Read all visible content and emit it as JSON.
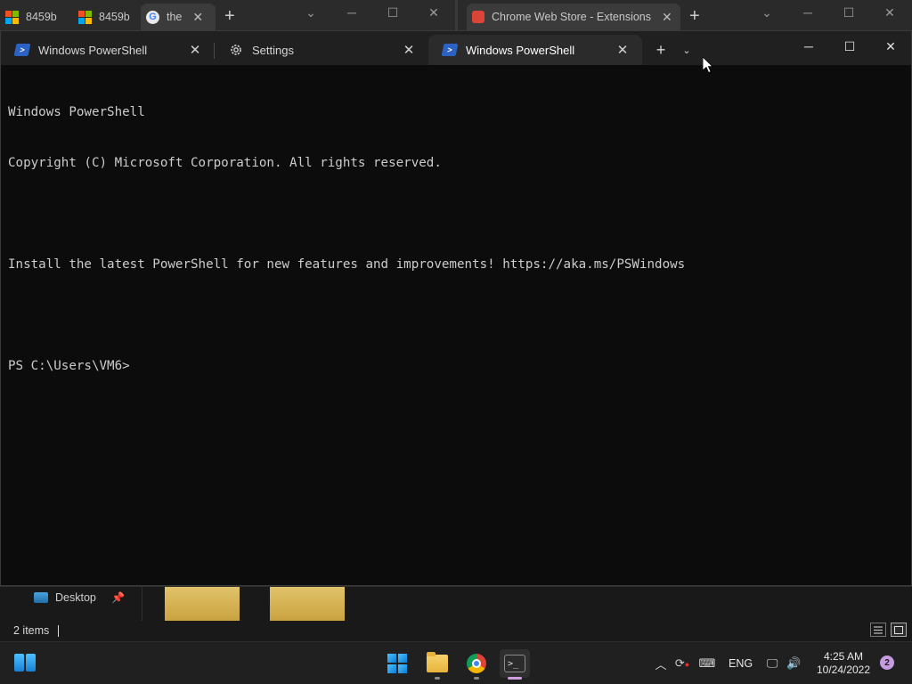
{
  "background_browser_left": {
    "tabs": [
      {
        "label": "8459b"
      },
      {
        "label": "8459b"
      },
      {
        "label": "the"
      }
    ]
  },
  "background_browser_right": {
    "tabs": [
      {
        "label": "Chrome Web Store - Extensions"
      }
    ]
  },
  "terminal": {
    "tabs": [
      {
        "label": "Windows PowerShell",
        "icon": "powershell-icon"
      },
      {
        "label": "Settings",
        "icon": "gear-icon"
      },
      {
        "label": "Windows PowerShell",
        "icon": "powershell-icon",
        "active": true
      }
    ],
    "new_tab_glyph": "+",
    "dropdown_glyph": "⌄",
    "console_lines": [
      "Windows PowerShell",
      "Copyright (C) Microsoft Corporation. All rights reserved.",
      "",
      "Install the latest PowerShell for new features and improvements! https://aka.ms/PSWindows",
      "",
      "PS C:\\Users\\VM6>"
    ]
  },
  "explorer": {
    "nav_item": "Desktop",
    "status_text": "2 items"
  },
  "taskbar": {
    "language": "ENG",
    "time": "4:25 AM",
    "date": "10/24/2022",
    "notification_count": "2"
  },
  "colors": {
    "console_bg": "#0c0c0c",
    "console_fg": "#cccccc",
    "tabbar_bg": "#202020",
    "active_tab_bg": "#2b2b2b",
    "taskbar_bg": "#202020",
    "accent": "#4cc2ff"
  }
}
